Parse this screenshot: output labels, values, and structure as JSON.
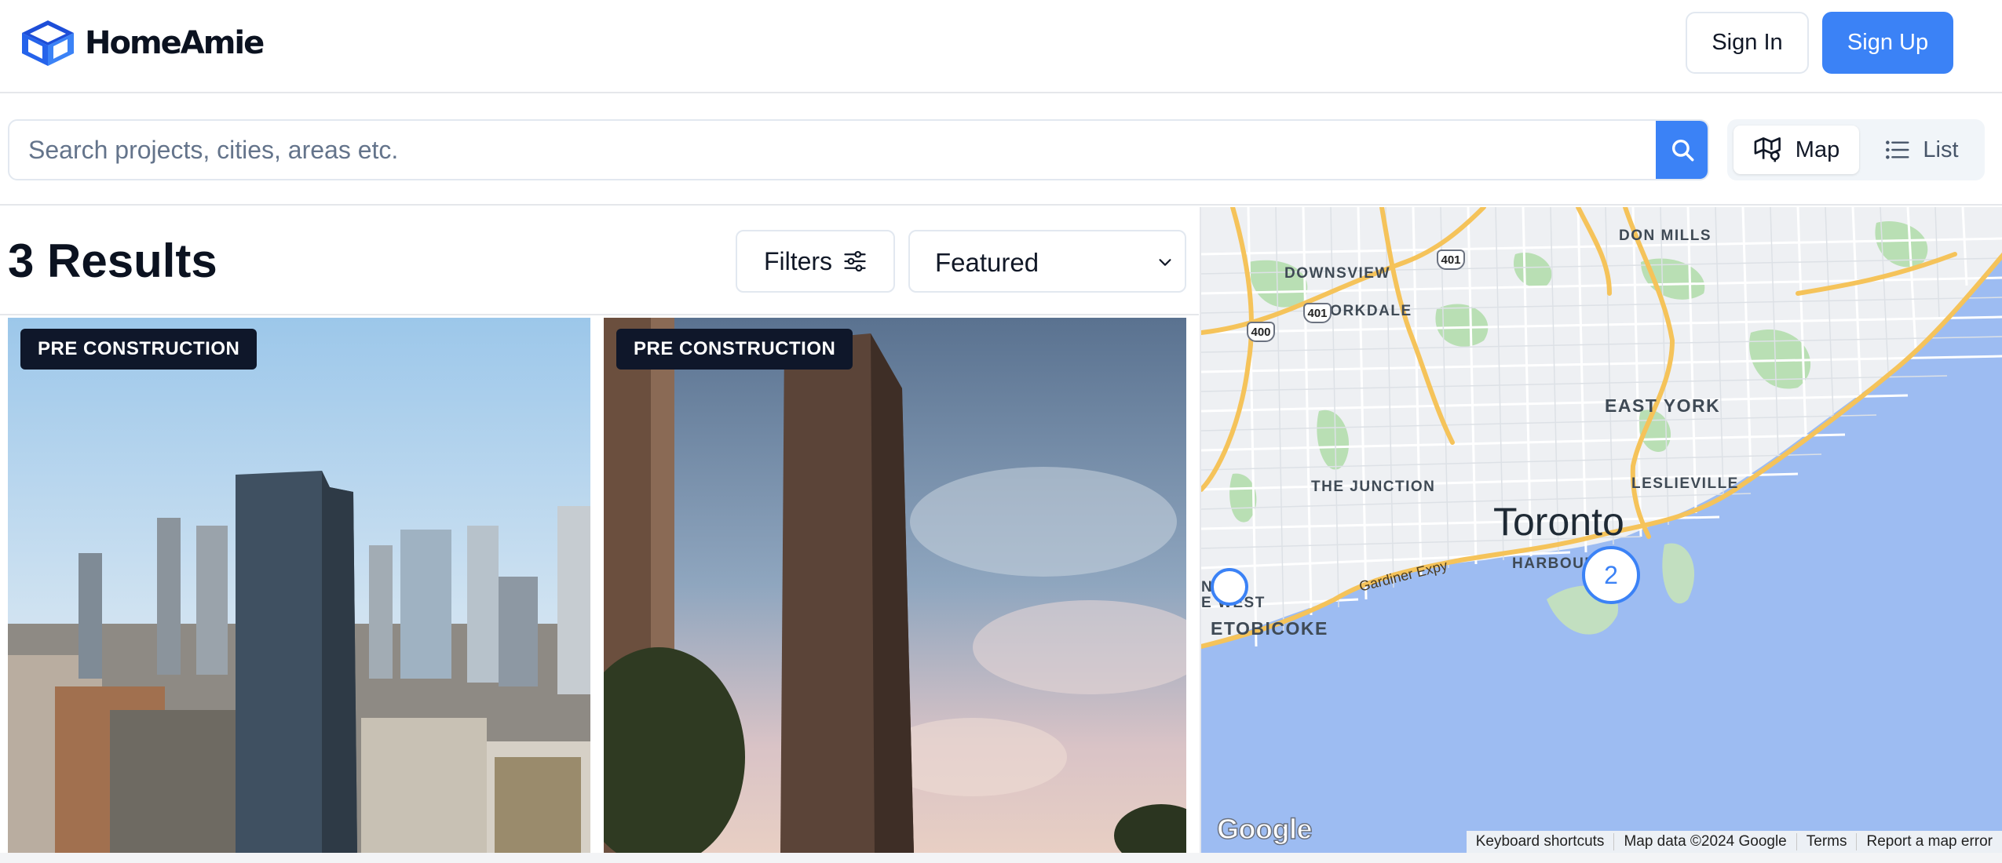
{
  "brand": {
    "name": "HomeAmie",
    "logo_icon": "isometric-box-logo",
    "accent": "#3b82f6"
  },
  "header": {
    "signin_label": "Sign In",
    "signup_label": "Sign Up"
  },
  "search": {
    "placeholder": "Search projects, cities, areas etc.",
    "value": "",
    "button_icon": "search-icon"
  },
  "view_toggle": {
    "map_label": "Map",
    "list_label": "List",
    "active": "Map",
    "map_icon": "map-pin-icon",
    "list_icon": "list-icon"
  },
  "results": {
    "title": "3 Results",
    "filters_label": "Filters",
    "filters_icon": "sliders-icon",
    "sort_value": "Featured"
  },
  "listings": [
    {
      "badge": "PRE CONSTRUCTION",
      "image": "glass-tower-downtown"
    },
    {
      "badge": "PRE CONSTRUCTION",
      "image": "tall-tower-sky"
    }
  ],
  "map": {
    "city": "Toronto",
    "neighbourhoods": {
      "don_mills": "DON MILLS",
      "downsview": "DOWNSVIEW",
      "yorkdale": "YORKDALE",
      "east_york": "EAST YORK",
      "the_junction": "THE JUNCTION",
      "leslieville": "LESLIEVILLE",
      "harbour": "HARBOUR",
      "etobicoke": "ETOBICOKE",
      "city_fragment": "N  TY",
      "west_fragment": "E WEST"
    },
    "highways": {
      "h401a": "401",
      "h401b": "401",
      "h400": "400"
    },
    "road": "Gardiner Expy",
    "cluster_count": "2",
    "google": "Google",
    "attribution": {
      "keyboard": "Keyboard shortcuts",
      "data": "Map data ©2024 Google",
      "terms": "Terms",
      "report": "Report a map error"
    }
  }
}
